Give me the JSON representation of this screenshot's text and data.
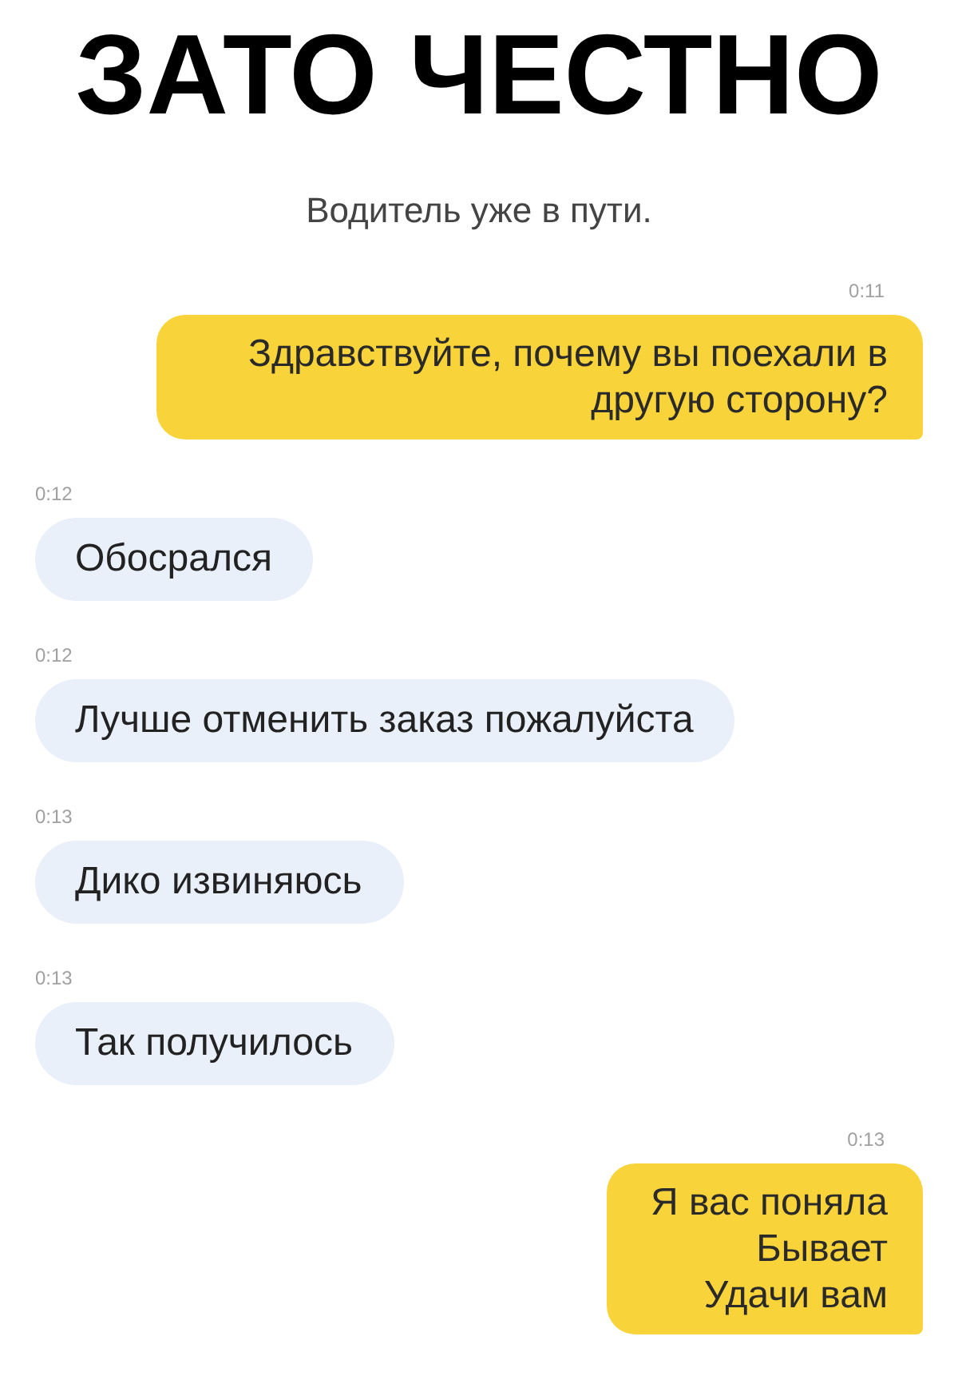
{
  "title": "ЗАТО ЧЕСТНО",
  "status": "Водитель уже в пути.",
  "messages": [
    {
      "kind": "outgoing",
      "time": "0:11",
      "text": "Здравствуйте, почему вы поехали в другую сторону?"
    },
    {
      "kind": "incoming",
      "time": "0:12",
      "text": "Обосрался"
    },
    {
      "kind": "incoming",
      "time": "0:12",
      "text": "Лучше отменить заказ пожалуйста"
    },
    {
      "kind": "incoming",
      "time": "0:13",
      "text": "Дико извиняюсь"
    },
    {
      "kind": "incoming",
      "time": "0:13",
      "text": "Так получилось"
    },
    {
      "kind": "outgoing",
      "time": "0:13",
      "text": "Я вас поняла\nБывает\nУдачи вам"
    }
  ]
}
